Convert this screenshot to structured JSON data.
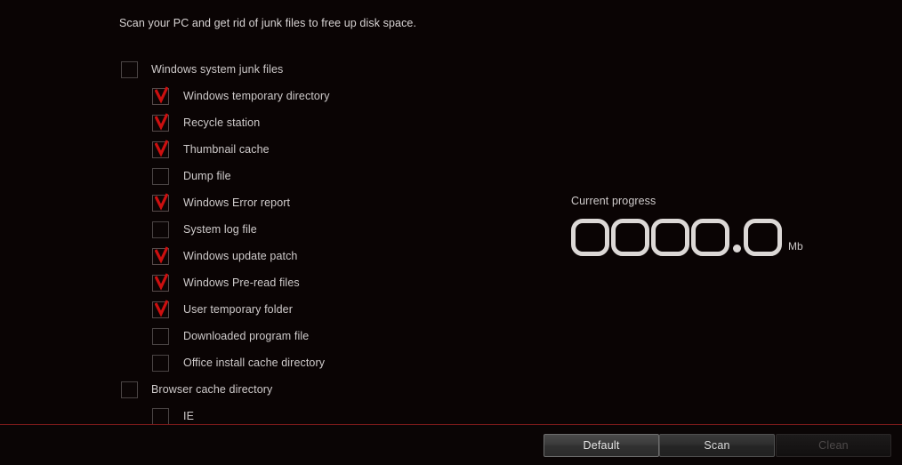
{
  "intro": {
    "text": "Scan your PC and get rid of junk files to free up disk space."
  },
  "checkbox_list": [
    {
      "label": "Windows system junk files",
      "level": 0,
      "checked": false
    },
    {
      "label": "Windows temporary directory",
      "level": 1,
      "checked": true
    },
    {
      "label": "Recycle station",
      "level": 1,
      "checked": true
    },
    {
      "label": "Thumbnail cache",
      "level": 1,
      "checked": true
    },
    {
      "label": "Dump file",
      "level": 1,
      "checked": false
    },
    {
      "label": "Windows Error report",
      "level": 1,
      "checked": true
    },
    {
      "label": "System log file",
      "level": 1,
      "checked": false
    },
    {
      "label": "Windows update patch",
      "level": 1,
      "checked": true
    },
    {
      "label": "Windows Pre-read files",
      "level": 1,
      "checked": true
    },
    {
      "label": "User temporary folder",
      "level": 1,
      "checked": true
    },
    {
      "label": "Downloaded program file",
      "level": 1,
      "checked": false
    },
    {
      "label": "Office install cache directory",
      "level": 1,
      "checked": false
    },
    {
      "label": "Browser cache directory",
      "level": 0,
      "checked": false
    },
    {
      "label": "IE",
      "level": 1,
      "checked": false
    }
  ],
  "progress": {
    "title": "Current progress",
    "value": "0000.0",
    "digits": [
      "0",
      "0",
      "0",
      "0",
      "0"
    ],
    "decimal_after": 4,
    "unit": "Mb"
  },
  "footer": {
    "buttons": [
      {
        "label": "Default",
        "state": "normal"
      },
      {
        "label": "Scan",
        "state": "normal"
      },
      {
        "label": "Clean",
        "state": "disabled"
      }
    ]
  },
  "colors": {
    "background": "#0a0404",
    "accent_red": "#cc0f0f",
    "divider_red": "#7d1a1a",
    "text": "#cfcbcb",
    "digit_outline": "#dcd8d6"
  }
}
